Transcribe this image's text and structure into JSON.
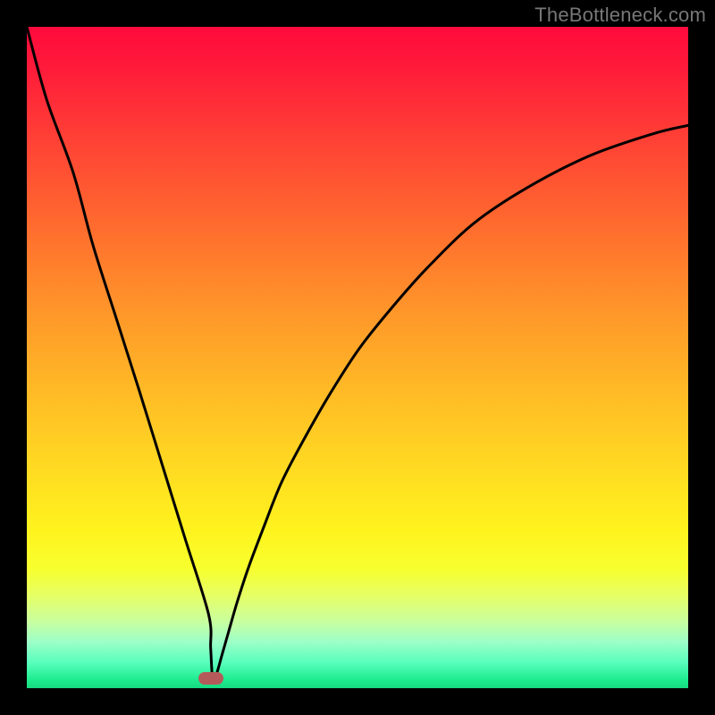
{
  "watermark": "TheBottleneck.com",
  "colors": {
    "curve": "#000000",
    "marker_fill": "#b55a5a",
    "frame": "#000000"
  },
  "chart_data": {
    "type": "line",
    "title": "",
    "xlabel": "",
    "ylabel": "",
    "xlim": [
      0,
      1
    ],
    "ylim": [
      0,
      1
    ],
    "grid": false,
    "legend": null,
    "notes": "Axes are unlabeled; both normalized to 0–1. Y is visually inverted (0 at top). Curve is a V-shaped bottleneck profile with minimum near x≈0.28. Values below are estimated from pixel positions.",
    "series": [
      {
        "name": "bottleneck-curve",
        "x": [
          0.0,
          0.03,
          0.07,
          0.1,
          0.135,
          0.17,
          0.205,
          0.24,
          0.275,
          0.278,
          0.281,
          0.287,
          0.295,
          0.305,
          0.318,
          0.335,
          0.358,
          0.385,
          0.42,
          0.459,
          0.503,
          0.55,
          0.605,
          0.676,
          0.757,
          0.851,
          0.946,
          1.0
        ],
        "y": [
          1.0,
          0.89,
          0.78,
          0.67,
          0.56,
          0.45,
          0.337,
          0.224,
          0.111,
          0.06,
          0.015,
          0.022,
          0.05,
          0.085,
          0.13,
          0.182,
          0.243,
          0.311,
          0.378,
          0.446,
          0.514,
          0.573,
          0.635,
          0.703,
          0.757,
          0.805,
          0.838,
          0.851
        ]
      }
    ],
    "marker": {
      "x": 0.278,
      "y": 0.015
    }
  }
}
